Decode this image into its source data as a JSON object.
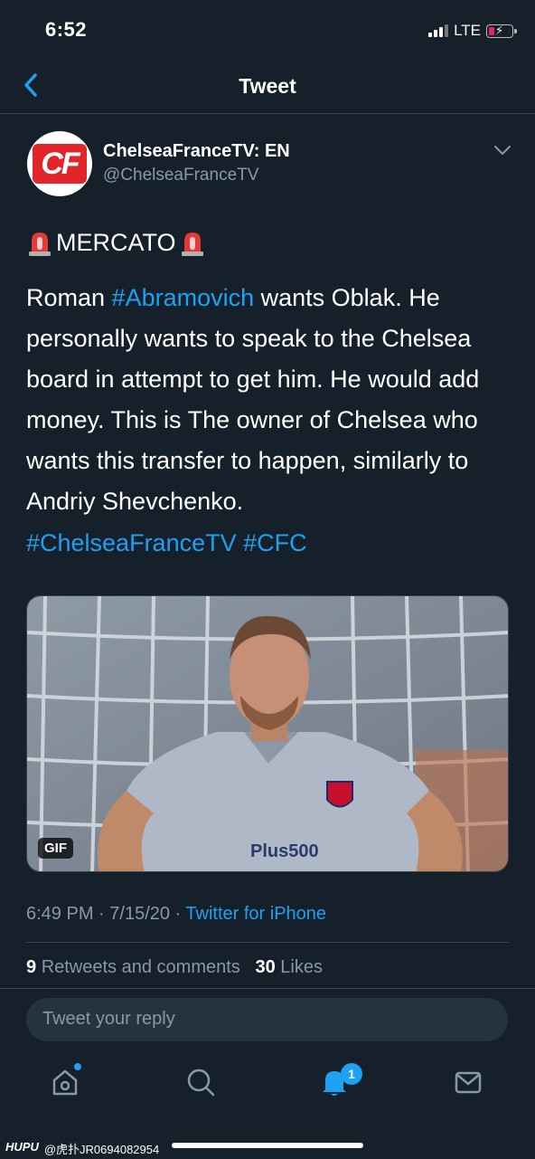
{
  "status_bar": {
    "time": "6:52",
    "network": "LTE"
  },
  "nav": {
    "title": "Tweet",
    "back_icon": "chevron-left-icon"
  },
  "author": {
    "logo_text": "CF",
    "name": "ChelseaFranceTV: EN",
    "handle": "@ChelseaFranceTV"
  },
  "tweet": {
    "mercato": "MERCATO",
    "body_parts": {
      "p1": "Roman ",
      "tag": "#Abramovich",
      "p2": " wants Oblak. He personally wants to speak to the Chelsea board in attempt to get him. He would add money. This is The owner of Chelsea who wants this transfer to happen, similarly to Andriy Shevchenko."
    },
    "hashtags": "#ChelseaFranceTV #CFC",
    "media": {
      "badge": "GIF",
      "sponsor_text": "Plus500"
    }
  },
  "meta": {
    "time": "6:49 PM",
    "sep": " · ",
    "date": "7/15/20",
    "source": "Twitter for iPhone"
  },
  "stats": {
    "retweets_count": "9",
    "retweets_label": "Retweets and comments",
    "likes_count": "30",
    "likes_label": "Likes"
  },
  "reply": {
    "placeholder": "Tweet your reply"
  },
  "tabs": {
    "notifications_badge": "1"
  },
  "watermark": {
    "brand": "HUPU",
    "text": "@虎扑JR0694082954"
  },
  "colors": {
    "background": "#15202b",
    "accent": "#1da1f2",
    "muted": "#8899a6",
    "divider": "#38444d"
  }
}
